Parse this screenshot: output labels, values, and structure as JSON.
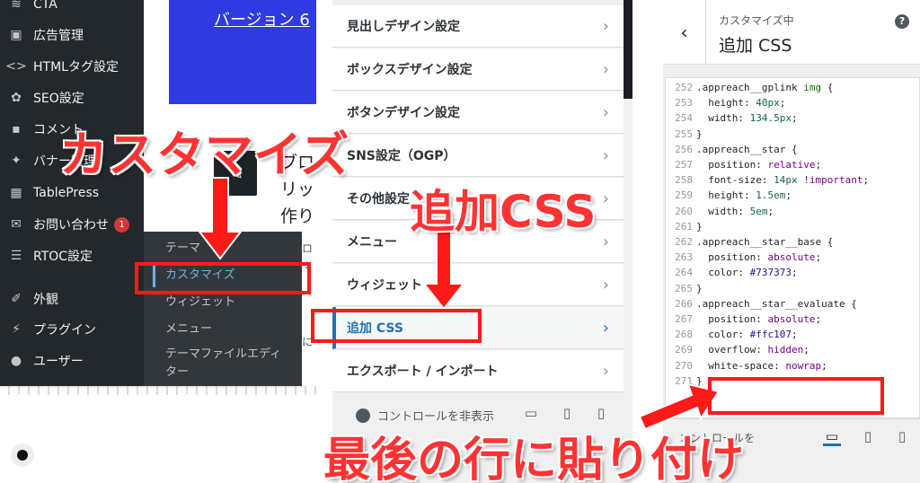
{
  "wp_admin": {
    "menu": [
      {
        "label": "CTA",
        "icon": "bars-icon"
      },
      {
        "label": "広告管理",
        "icon": "ad-icon"
      },
      {
        "label": "HTMLタグ設定",
        "icon": "code-icon"
      },
      {
        "label": "SEO設定",
        "icon": "gear-icon"
      },
      {
        "label": "コメント",
        "icon": "comment-icon"
      },
      {
        "label": "バナー管理",
        "icon": "pin-icon"
      },
      {
        "label": "TablePress",
        "icon": "table-icon"
      },
      {
        "label": "お問い合わせ",
        "icon": "mail-icon",
        "badge": "1"
      },
      {
        "label": "RTOC設定",
        "icon": "list-icon"
      },
      {
        "label": "外観",
        "icon": "brush-icon"
      },
      {
        "label": "プラグイン",
        "icon": "plugin-icon"
      },
      {
        "label": "ユーザー",
        "icon": "user-icon"
      }
    ],
    "submenu": [
      "テーマ",
      "カスタマイズ",
      "ウィジェット",
      "メニュー",
      "テーマファイルエディ",
      "ター"
    ],
    "version_link": "バージョン 6",
    "block_text": [
      "ブロ",
      "リッ",
      "作り"
    ],
    "fragments": [
      "ロッ",
      "に"
    ]
  },
  "customizer": {
    "rows": [
      "見出しデザイン設定",
      "ボックスデザイン設定",
      "ボタンデザイン設定",
      "SNS設定（OGP）",
      "その他設定",
      "メニュー",
      "ウィジェット",
      "追加 CSS",
      "エクスポート / インポート"
    ],
    "active_row": "追加 CSS",
    "hide_controls": "コントロールを非表示"
  },
  "css_panel": {
    "subtitle": "カスタマイズ中",
    "title": "追加 CSS",
    "hide_controls_fragment": "コントロールを",
    "code": [
      {
        "n": "252",
        "t": [
          [
            "c-sel",
            ".appreach__gplink "
          ],
          [
            "c-tag",
            "img"
          ],
          [
            "c-sel",
            " {"
          ]
        ]
      },
      {
        "n": "253",
        "t": [
          [
            "c-prop",
            "  height: "
          ],
          [
            "c-num",
            "40px"
          ],
          [
            "c-prop",
            ";"
          ]
        ]
      },
      {
        "n": "254",
        "t": [
          [
            "c-prop",
            "  width: "
          ],
          [
            "c-num",
            "134.5px"
          ],
          [
            "c-prop",
            ";"
          ]
        ]
      },
      {
        "n": "255",
        "t": [
          [
            "c-sel",
            "}"
          ]
        ]
      },
      {
        "n": "256",
        "t": [
          [
            "c-sel",
            ".appreach__star {"
          ]
        ]
      },
      {
        "n": "257",
        "t": [
          [
            "c-prop",
            "  position: "
          ],
          [
            "c-kw",
            "relative"
          ],
          [
            "c-prop",
            ";"
          ]
        ]
      },
      {
        "n": "258",
        "t": [
          [
            "c-prop",
            "  font-size: "
          ],
          [
            "c-num",
            "14px"
          ],
          [
            "c-prop",
            " "
          ],
          [
            "c-kw",
            "!important"
          ],
          [
            "c-prop",
            ";"
          ]
        ]
      },
      {
        "n": "259",
        "t": [
          [
            "c-prop",
            "  height: "
          ],
          [
            "c-num",
            "1.5em"
          ],
          [
            "c-prop",
            ";"
          ]
        ]
      },
      {
        "n": "260",
        "t": [
          [
            "c-prop",
            "  width: "
          ],
          [
            "c-num",
            "5em"
          ],
          [
            "c-prop",
            ";"
          ]
        ]
      },
      {
        "n": "261",
        "t": [
          [
            "c-sel",
            "}"
          ]
        ]
      },
      {
        "n": "262",
        "t": [
          [
            "c-sel",
            ".appreach__star__base {"
          ]
        ]
      },
      {
        "n": "263",
        "t": [
          [
            "c-prop",
            "  position: "
          ],
          [
            "c-kw",
            "absolute"
          ],
          [
            "c-prop",
            ";"
          ]
        ]
      },
      {
        "n": "264",
        "t": [
          [
            "c-prop",
            "  color: "
          ],
          [
            "c-str",
            "#737373"
          ],
          [
            "c-prop",
            ";"
          ]
        ]
      },
      {
        "n": "265",
        "t": [
          [
            "c-sel",
            "}"
          ]
        ]
      },
      {
        "n": "266",
        "t": [
          [
            "c-sel",
            ".appreach__star__evaluate {"
          ]
        ]
      },
      {
        "n": "267",
        "t": [
          [
            "c-prop",
            "  position: "
          ],
          [
            "c-kw",
            "absolute"
          ],
          [
            "c-prop",
            ";"
          ]
        ]
      },
      {
        "n": "268",
        "t": [
          [
            "c-prop",
            "  color: "
          ],
          [
            "c-str",
            "#ffc107"
          ],
          [
            "c-prop",
            ";"
          ]
        ]
      },
      {
        "n": "269",
        "t": [
          [
            "c-prop",
            "  overflow: "
          ],
          [
            "c-kw",
            "hidden"
          ],
          [
            "c-prop",
            ";"
          ]
        ]
      },
      {
        "n": "270",
        "t": [
          [
            "c-prop",
            "  white-space: "
          ],
          [
            "c-kw",
            "nowrap"
          ],
          [
            "c-prop",
            ";"
          ]
        ]
      },
      {
        "n": "271",
        "t": [
          [
            "c-sel",
            "}"
          ]
        ]
      }
    ]
  },
  "annotations": {
    "customize": "カスタマイズ",
    "add_css": "追加CSS",
    "paste_last_line": "最後の行に貼り付け",
    "color": "#ff1a1a"
  }
}
